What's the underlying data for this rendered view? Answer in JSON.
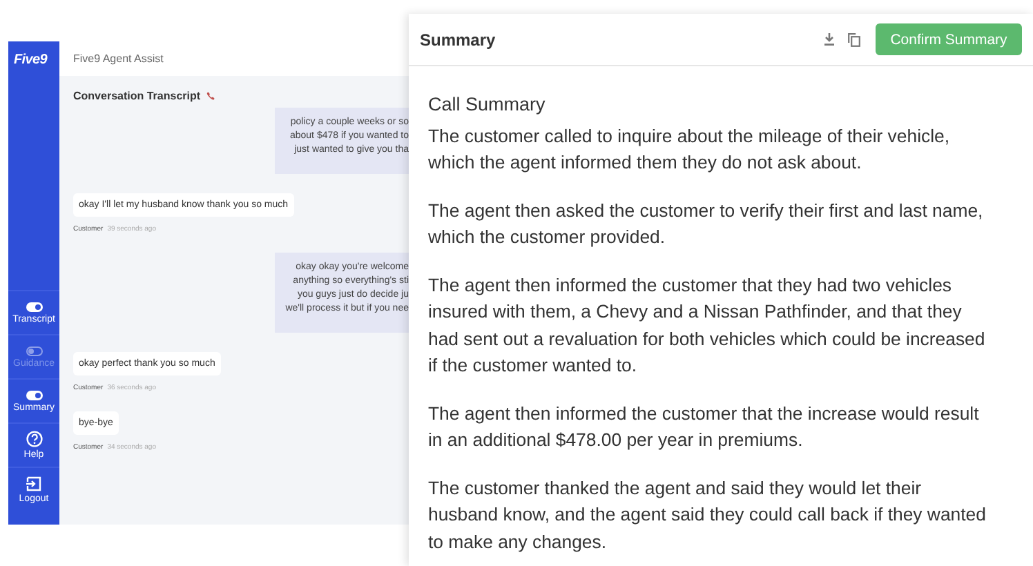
{
  "app": {
    "logo": "Five9",
    "title": "Five9 Agent Assist"
  },
  "sidebar": {
    "items": [
      {
        "kind": "toggle",
        "label": "Transcript",
        "on": true,
        "disabled": false
      },
      {
        "kind": "toggle",
        "label": "Guidance",
        "on": false,
        "disabled": true
      },
      {
        "kind": "toggle",
        "label": "Summary",
        "on": true,
        "disabled": false
      },
      {
        "kind": "help",
        "label": "Help",
        "disabled": false
      },
      {
        "kind": "logout",
        "label": "Logout",
        "disabled": false
      }
    ]
  },
  "transcript": {
    "heading": "Conversation Transcript",
    "messages": [
      {
        "kind": "agent",
        "lines": [
          "policy a couple weeks or so",
          "about $478 if you wanted to",
          "just wanted to give you tha"
        ]
      },
      {
        "kind": "customer",
        "text": "okay I'll let my husband know thank you so much",
        "sender": "Customer",
        "time": "39 seconds ago"
      },
      {
        "kind": "agent",
        "lines": [
          "okay okay you're welcome",
          "anything so everything's sti",
          "you guys just do decide ju",
          "we'll process it but if you nee"
        ]
      },
      {
        "kind": "customer",
        "text": "okay perfect thank you so much",
        "sender": "Customer",
        "time": "36 seconds ago"
      },
      {
        "kind": "customer",
        "text": "bye-bye",
        "sender": "Customer",
        "time": "34 seconds ago"
      }
    ]
  },
  "summary": {
    "title": "Summary",
    "confirm_button": "Confirm Summary",
    "heading": "Call Summary",
    "paragraphs": [
      "The customer called to inquire about the mileage of their vehicle, which the agent informed them they do not ask about.",
      "The agent then asked the customer to verify their first and last name, which the customer provided.",
      "The agent then informed the customer that they had two vehicles insured with them, a Chevy and a Nissan Pathfinder, and that they had sent out a revaluation for both vehicles which could be increased if the customer wanted to.",
      "The agent then informed the customer that the increase would result in an additional $478.00 per year in premiums.",
      "The customer thanked the agent and said they would let their husband know, and the agent said they could call back if they wanted to make any changes."
    ]
  }
}
